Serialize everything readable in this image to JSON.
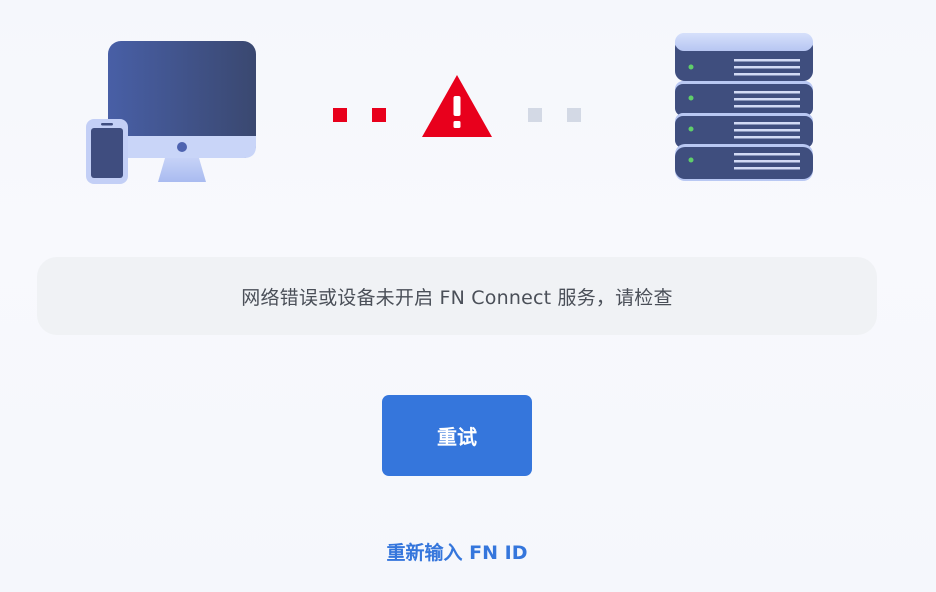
{
  "illustration": {
    "client_icon": "desktop-and-phone-icon",
    "server_icon": "server-stack-icon",
    "warning_icon": "warning-triangle-icon",
    "error_color": "#e8001c",
    "inactive_color": "#d3d9e5"
  },
  "message": {
    "text": "网络错误或设备未开启 FN Connect 服务，请检查"
  },
  "actions": {
    "retry_label": "重试",
    "reenter_label": "重新输入 FN ID"
  },
  "colors": {
    "accent": "#3576dc",
    "message_bg": "#f0f2f5"
  }
}
